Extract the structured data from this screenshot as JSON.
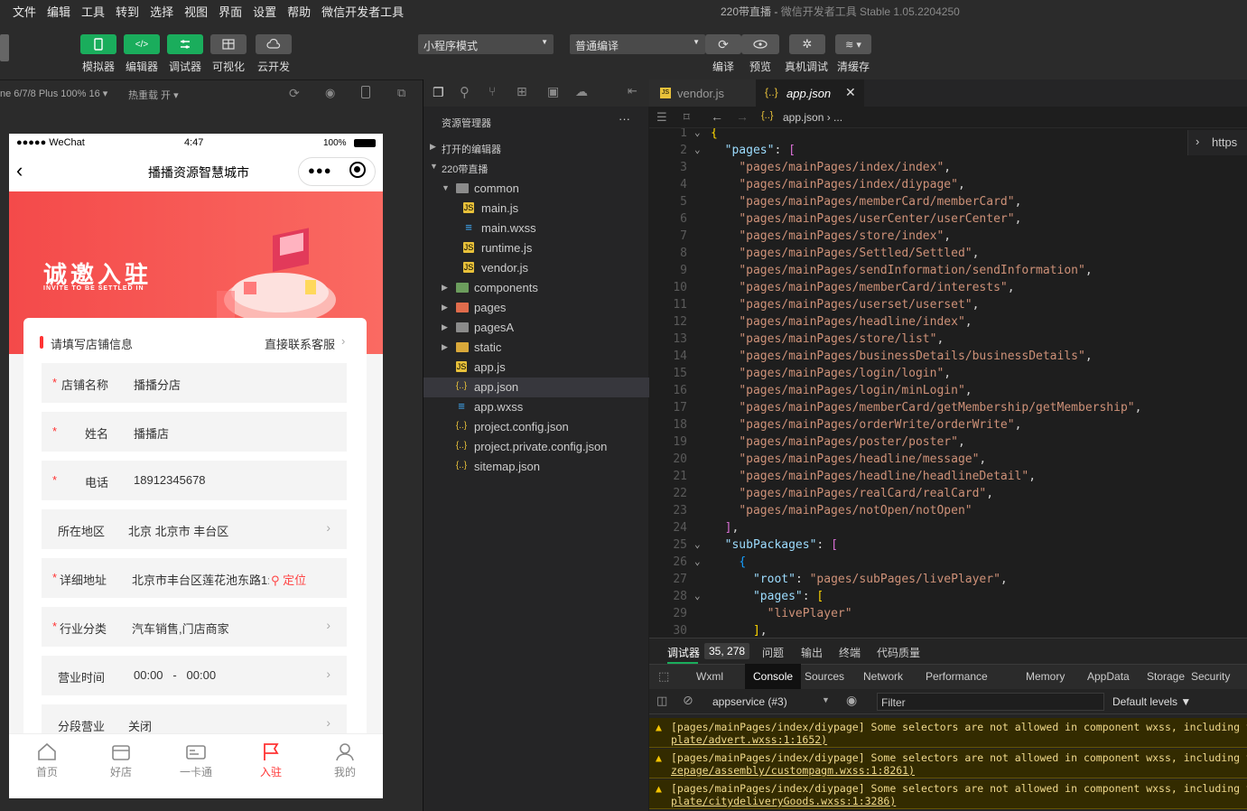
{
  "menu": [
    "文件",
    "编辑",
    "工具",
    "转到",
    "选择",
    "视图",
    "界面",
    "设置",
    "帮助",
    "微信开发者工具"
  ],
  "window_title": {
    "project": "220带直播",
    "sep": " - ",
    "app": "微信开发者工具 Stable 1.05.2204250"
  },
  "toolbar": {
    "simulator": "模拟器",
    "editor": "编辑器",
    "debugger": "调试器",
    "visual": "可视化",
    "cloud": "云开发",
    "mode": "小程序模式",
    "compile_mode": "普通编译",
    "compile": "编译",
    "preview": "预览",
    "real_debug": "真机调试",
    "clear_cache": "清缓存"
  },
  "simbar": {
    "device": "ne 6/7/8 Plus 100% 16",
    "hot_reload": "热重载 开"
  },
  "phone": {
    "carrier": "●●●●● WeChat",
    "time": "4:47",
    "battery": "100%",
    "nav_title": "播播资源智慧城市",
    "banner_title": "诚邀入驻",
    "banner_sub": "INVITE TO BE SETTLED IN",
    "section_title": "请填写店铺信息",
    "contact": "直接联系客服",
    "fields": [
      {
        "label": "店铺名称",
        "value": "播播分店"
      },
      {
        "label": "姓名",
        "value": "播播店"
      },
      {
        "label": "电话",
        "value": "18912345678"
      },
      {
        "label": "所在地区",
        "value": "北京 北京市 丰台区"
      },
      {
        "label": "详细地址",
        "value": "北京市丰台区莲花池东路1:",
        "extra": "定位"
      },
      {
        "label": "行业分类",
        "value": "汽车销售,门店商家"
      },
      {
        "label": "营业时间",
        "value": "00:00   -   00:00"
      },
      {
        "label": "分段营业",
        "value": "关闭"
      }
    ],
    "tabs": [
      {
        "label": "首页"
      },
      {
        "label": "好店"
      },
      {
        "label": "一卡通"
      },
      {
        "label": "入驻"
      },
      {
        "label": "我的"
      }
    ]
  },
  "explorer": {
    "header": "资源管理器",
    "open_editors": "打开的编辑器",
    "project": "220带直播",
    "tree": [
      {
        "name": "common",
        "type": "folder-open",
        "depth": 1
      },
      {
        "name": "main.js",
        "type": "js",
        "depth": 2
      },
      {
        "name": "main.wxss",
        "type": "wxss",
        "depth": 2
      },
      {
        "name": "runtime.js",
        "type": "js",
        "depth": 2
      },
      {
        "name": "vendor.js",
        "type": "js",
        "depth": 2
      },
      {
        "name": "components",
        "type": "folder-g",
        "depth": 1
      },
      {
        "name": "pages",
        "type": "folder-r",
        "depth": 1
      },
      {
        "name": "pagesA",
        "type": "folder",
        "depth": 1
      },
      {
        "name": "static",
        "type": "folder-y",
        "depth": 1
      },
      {
        "name": "app.js",
        "type": "js",
        "depth": 1
      },
      {
        "name": "app.json",
        "type": "json",
        "depth": 1,
        "selected": true
      },
      {
        "name": "app.wxss",
        "type": "wxss",
        "depth": 1
      },
      {
        "name": "project.config.json",
        "type": "json",
        "depth": 1
      },
      {
        "name": "project.private.config.json",
        "type": "json",
        "depth": 1
      },
      {
        "name": "sitemap.json",
        "type": "json",
        "depth": 1
      }
    ]
  },
  "editor": {
    "tabs": [
      {
        "name": "vendor.js"
      },
      {
        "name": "app.json",
        "active": true
      }
    ],
    "crumb": "app.json",
    "hint": "https",
    "pages": [
      "pages/mainPages/index/index",
      "pages/mainPages/index/diypage",
      "pages/mainPages/memberCard/memberCard",
      "pages/mainPages/userCenter/userCenter",
      "pages/mainPages/store/index",
      "pages/mainPages/Settled/Settled",
      "pages/mainPages/sendInformation/sendInformation",
      "pages/mainPages/memberCard/interests",
      "pages/mainPages/userset/userset",
      "pages/mainPages/headline/index",
      "pages/mainPages/store/list",
      "pages/mainPages/businessDetails/businessDetails",
      "pages/mainPages/login/login",
      "pages/mainPages/login/minLogin",
      "pages/mainPages/memberCard/getMembership/getMembership",
      "pages/mainPages/orderWrite/orderWrite",
      "pages/mainPages/poster/poster",
      "pages/mainPages/headline/message",
      "pages/mainPages/headline/headlineDetail",
      "pages/mainPages/realCard/realCard",
      "pages/mainPages/notOpen/notOpen"
    ],
    "sub_root": "pages/subPages/livePlayer",
    "sub_page": "livePlayer"
  },
  "devtools": {
    "tabs": [
      "调试器",
      "35, 278",
      "问题",
      "输出",
      "终端",
      "代码质量"
    ],
    "console_tabs": [
      "Wxml",
      "Console",
      "Sources",
      "Network",
      "Performance",
      "Memory",
      "AppData",
      "Storage",
      "Security"
    ],
    "context": "appservice (#3)",
    "filter": "Filter",
    "levels": "Default levels ▼",
    "messages": [
      {
        "text": "[pages/mainPages/index/diypage] Some selectors are not allowed in component wxss, including tag n",
        "link": "plate/advert.wxss:1:1652)"
      },
      {
        "text": "[pages/mainPages/index/diypage] Some selectors are not allowed in component wxss, including tag n",
        "link": "zepage/assembly/custompagm.wxss:1:8261)"
      },
      {
        "text": "[pages/mainPages/index/diypage] Some selectors are not allowed in component wxss, including tag n",
        "link": "plate/citydeliveryGoods.wxss:1:3286)"
      }
    ]
  }
}
